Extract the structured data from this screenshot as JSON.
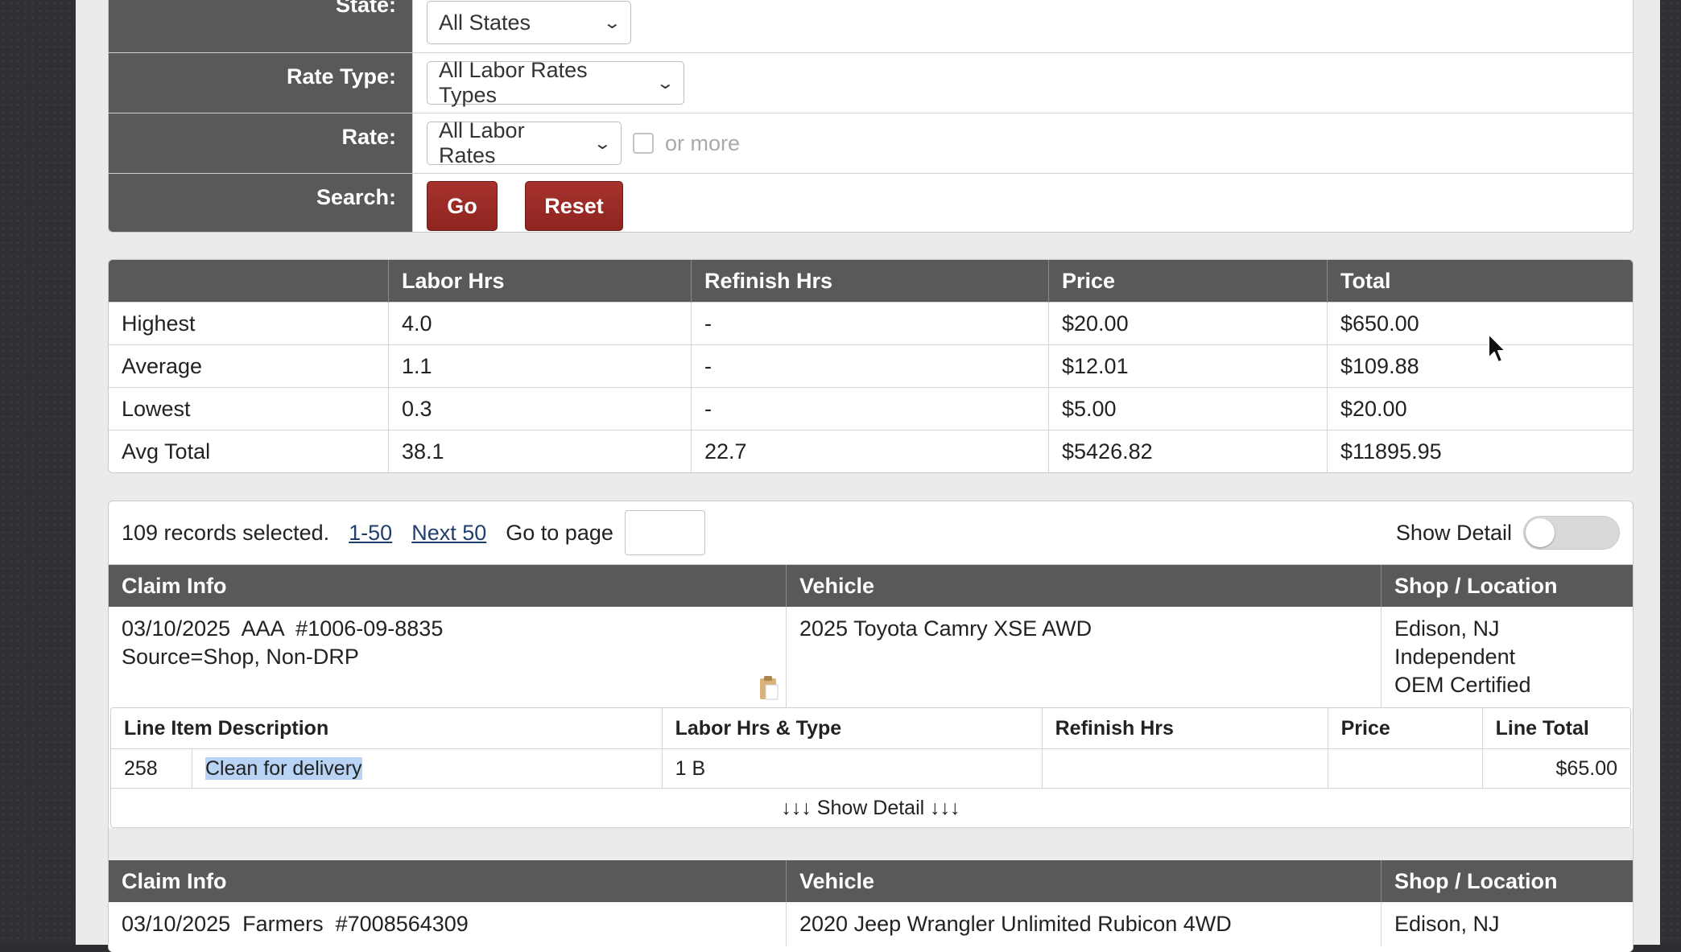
{
  "search_form": {
    "rows": [
      {
        "label": "State:",
        "select": "All States"
      },
      {
        "label": "Rate Type:",
        "select": "All Labor Rates Types"
      },
      {
        "label": "Rate:",
        "select": "All Labor Rates",
        "checkbox_label": "or more"
      },
      {
        "label": "Search:"
      }
    ],
    "go_label": "Go",
    "reset_label": "Reset"
  },
  "stats": {
    "headers": [
      "",
      "Labor Hrs",
      "Refinish Hrs",
      "Price",
      "Total"
    ],
    "rows": [
      [
        "Highest",
        "4.0",
        "-",
        "$20.00",
        "$650.00"
      ],
      [
        "Average",
        "1.1",
        "-",
        "$12.01",
        "$109.88"
      ],
      [
        "Lowest",
        "0.3",
        "-",
        "$5.00",
        "$20.00"
      ],
      [
        "Avg Total",
        "38.1",
        "22.7",
        "$5426.82",
        "$11895.95"
      ]
    ]
  },
  "records": {
    "summary": "109 records selected.",
    "range_link": "1-50",
    "next_link": "Next 50",
    "goto_label": "Go to page",
    "show_detail_label": "Show Detail"
  },
  "claims": [
    {
      "headers": [
        "Claim Info",
        "Vehicle",
        "Shop / Location"
      ],
      "claim_line1": "03/10/2025  AAA  #1006-09-8835",
      "claim_line2": "Source=Shop, Non-DRP",
      "vehicle": "2025 Toyota Camry XSE AWD",
      "shop_lines": [
        "Edison, NJ",
        "Independent",
        "OEM Certified"
      ],
      "line_headers": [
        "Line Item Description",
        "Labor Hrs & Type",
        "Refinish Hrs",
        "Price",
        "Line Total"
      ],
      "line_items": [
        {
          "num": "258",
          "desc": "Clean for delivery",
          "labor": "1 B",
          "refinish": "",
          "price": "",
          "total": "$65.00"
        }
      ],
      "show_detail_link": "↓↓↓ Show Detail ↓↓↓"
    },
    {
      "headers": [
        "Claim Info",
        "Vehicle",
        "Shop / Location"
      ],
      "claim_line1": "03/10/2025  Farmers  #7008564309",
      "vehicle": "2020 Jeep Wrangler Unlimited Rubicon 4WD",
      "shop_lines": [
        "Edison, NJ"
      ]
    }
  ],
  "colors": {
    "header_bg": "#595959",
    "button_bg": "#9b2a26",
    "link": "#1f3f6e",
    "selection_highlight": "#b9d3f5"
  }
}
